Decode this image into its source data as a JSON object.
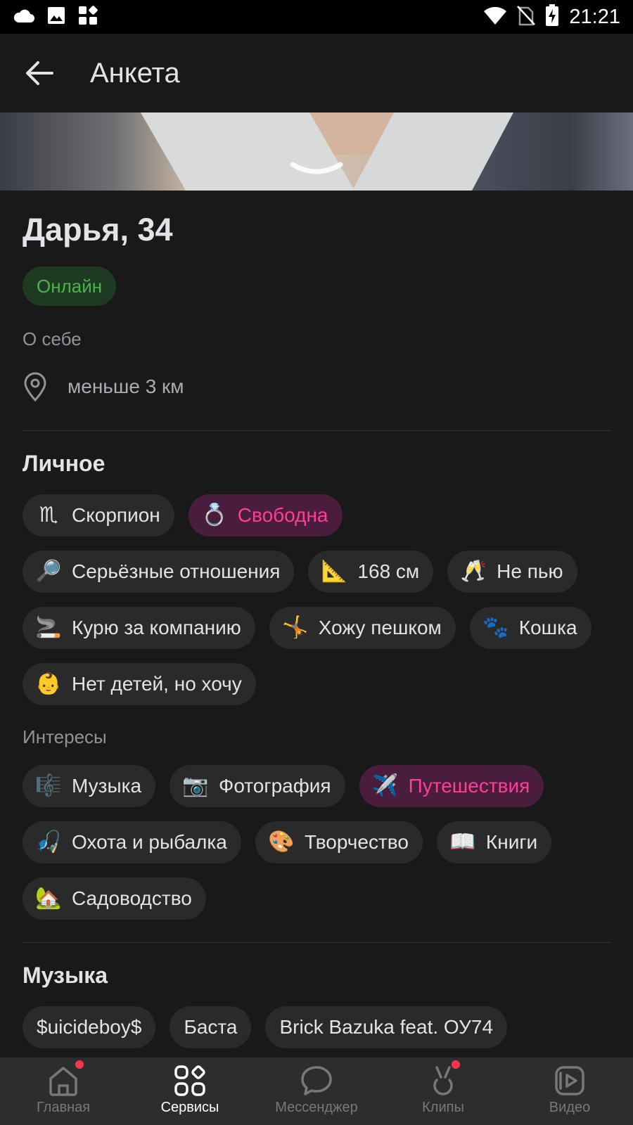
{
  "statusbar": {
    "time": "21:21"
  },
  "header": {
    "title": "Анкета"
  },
  "profile": {
    "name": "Дарья, 34",
    "status": "Онлайн",
    "about_label": "О себе",
    "distance": "меньше 3 км"
  },
  "personal": {
    "title": "Личное",
    "chips": [
      {
        "emoji": "♏",
        "label": "Скорпион",
        "highlight": false
      },
      {
        "emoji": "💍",
        "label": "Свободна",
        "highlight": true
      },
      {
        "emoji": "🔎",
        "label": "Серьёзные отношения",
        "highlight": false
      },
      {
        "emoji": "📐",
        "label": "168 см",
        "highlight": false
      },
      {
        "emoji": "🥂",
        "label": "Не пью",
        "highlight": false
      },
      {
        "emoji": "🚬",
        "label": "Курю за компанию",
        "highlight": false
      },
      {
        "emoji": "🤸",
        "label": "Хожу пешком",
        "highlight": false
      },
      {
        "emoji": "🐾",
        "label": "Кошка",
        "highlight": false
      },
      {
        "emoji": "👶",
        "label": "Нет детей, но хочу",
        "highlight": false
      }
    ]
  },
  "interests": {
    "title": "Интересы",
    "chips": [
      {
        "emoji": "🎼",
        "label": "Музыка",
        "highlight": false
      },
      {
        "emoji": "📷",
        "label": "Фотография",
        "highlight": false
      },
      {
        "emoji": "✈️",
        "label": "Путешествия",
        "highlight": true
      },
      {
        "emoji": "🎣",
        "label": "Охота и рыбалка",
        "highlight": false
      },
      {
        "emoji": "🎨",
        "label": "Творчество",
        "highlight": false
      },
      {
        "emoji": "📖",
        "label": "Книги",
        "highlight": false
      },
      {
        "emoji": "🏡",
        "label": "Садоводство",
        "highlight": false
      }
    ]
  },
  "music": {
    "title": "Музыка",
    "chips": [
      "$uicideboy$",
      "Баста",
      "Brick Bazuka feat. ОУ74"
    ]
  },
  "bottomnav": {
    "items": [
      {
        "label": "Главная",
        "icon": "home-icon",
        "active": false,
        "dot": true
      },
      {
        "label": "Сервисы",
        "icon": "services-icon",
        "active": true,
        "dot": false
      },
      {
        "label": "Мессенджер",
        "icon": "messenger-icon",
        "active": false,
        "dot": false
      },
      {
        "label": "Клипы",
        "icon": "clips-icon",
        "active": false,
        "dot": true
      },
      {
        "label": "Видео",
        "icon": "video-icon",
        "active": false,
        "dot": false
      }
    ]
  },
  "colors": {
    "background": "#19191a",
    "chip": "#2a2a2b",
    "highlight_bg": "#4b1d3d",
    "highlight_text": "#ff3d9a",
    "online_text": "#4bb34b",
    "online_bg": "#1f3a23",
    "nav_dot": "#ff3347"
  }
}
